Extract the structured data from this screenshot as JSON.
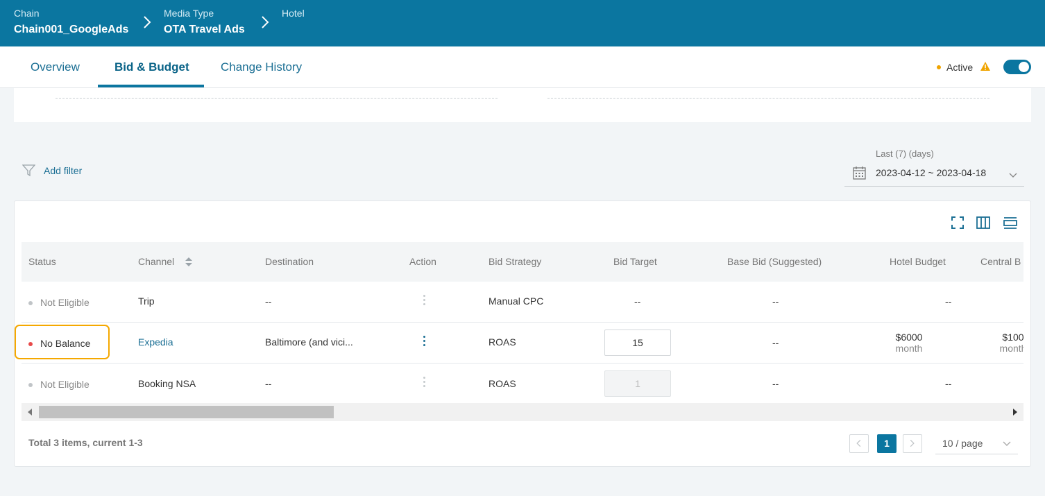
{
  "breadcrumb": [
    {
      "label": "Chain",
      "value": "Chain001_GoogleAds"
    },
    {
      "label": "Media Type",
      "value": "OTA Travel Ads"
    },
    {
      "label": "Hotel",
      "value": ""
    }
  ],
  "tabs": [
    "Overview",
    "Bid & Budget",
    "Change History"
  ],
  "active_tab": "Bid & Budget",
  "status": {
    "label": "Active",
    "dot_color": "#f0a400",
    "warning_icon": "warning-icon",
    "toggle_on": true
  },
  "filter": {
    "add_label": "Add filter"
  },
  "date_range": {
    "label": "Last (7) (days)",
    "value": "2023-04-12 ~ 2023-04-18"
  },
  "table": {
    "columns": [
      "Status",
      "Channel",
      "Destination",
      "Action",
      "Bid Strategy",
      "Bid Target",
      "Base Bid (Suggested)",
      "Hotel Budget",
      "Central B"
    ],
    "rows": [
      {
        "status": "Not Eligible",
        "status_color": "#c0c4c7",
        "channel": "Trip",
        "destination": "--",
        "bid_strategy": "Manual CPC",
        "bid_target": "--",
        "base_bid": "--",
        "hotel_budget": "--",
        "central_budget": ""
      },
      {
        "status": "No Balance",
        "status_color": "#e84a4a",
        "channel": "Expedia",
        "destination": "Baltimore (and vici...",
        "bid_strategy": "ROAS",
        "bid_target": "15",
        "base_bid": "--",
        "hotel_budget": "$6000",
        "hotel_budget_unit": "month",
        "central_budget": "$100",
        "central_budget_unit": "month"
      },
      {
        "status": "Not Eligible",
        "status_color": "#c0c4c7",
        "channel": "Booking NSA",
        "destination": "--",
        "bid_strategy": "ROAS",
        "bid_target": "1",
        "base_bid": "--",
        "hotel_budget": "--",
        "central_budget": ""
      }
    ]
  },
  "footer": {
    "total": "Total 3 items, current 1-3",
    "current_page": "1",
    "page_size": "10 / page"
  },
  "colors": {
    "primary": "#0b76a0",
    "highlight": "#f5a800"
  }
}
